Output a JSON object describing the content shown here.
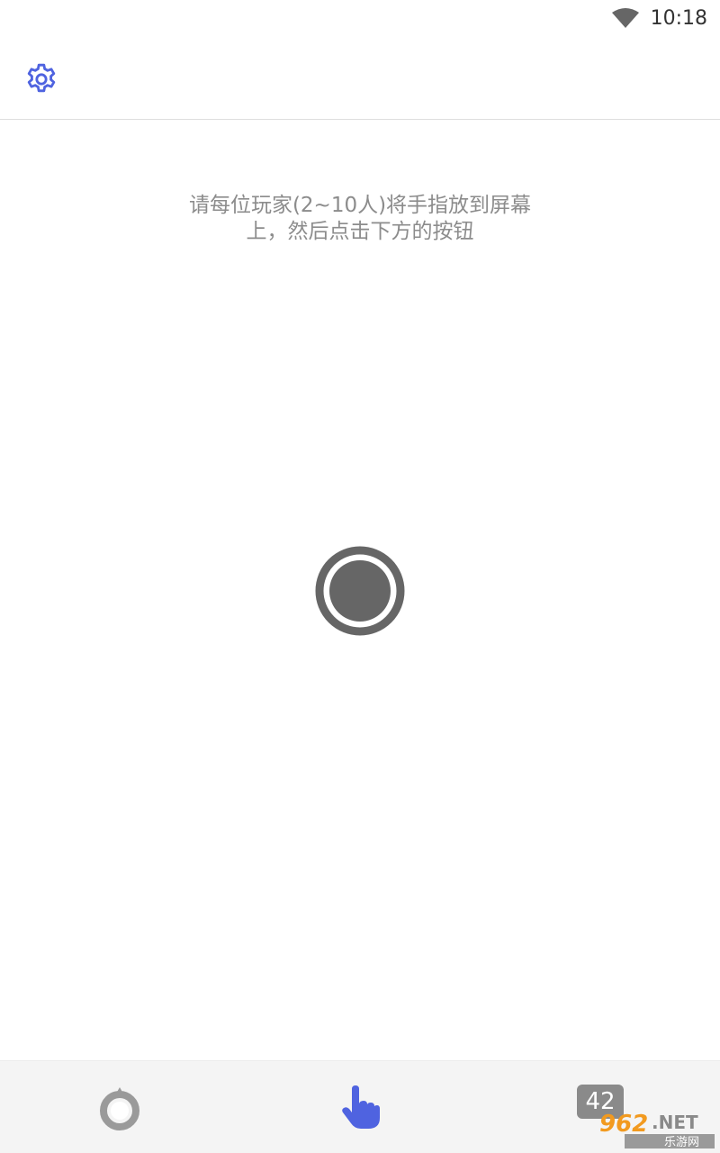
{
  "status_bar": {
    "time": "10:18",
    "wifi_icon": "wifi-icon"
  },
  "app_bar": {
    "settings_icon": "gear-icon",
    "accent_color": "#4f63e0"
  },
  "instruction": {
    "line1": "请每位玩家(2~10人)将手指放到屏幕",
    "line2": "上，然后点击下方的按钮"
  },
  "start_button": {
    "icon": "record-button-icon",
    "color": "#666666"
  },
  "bottom_nav": {
    "items": [
      {
        "icon": "circle-target-icon",
        "active": false
      },
      {
        "icon": "pointing-finger-icon",
        "active": true
      },
      {
        "icon": "number-badge-icon",
        "label": "42",
        "active": false
      }
    ],
    "active_color": "#4f63e0",
    "inactive_color": "#9a9a9a"
  },
  "watermark": {
    "text_top": "962.NET",
    "text_bottom": "乐游网"
  }
}
